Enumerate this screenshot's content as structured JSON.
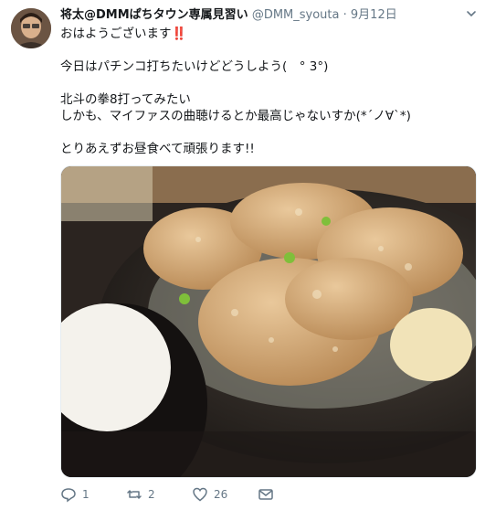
{
  "tweet": {
    "display_name": "将太@DMMぱちタウン専属見習い",
    "handle": "@DMM_syouta",
    "separator": "·",
    "date": "9月12日",
    "lines": [
      "おはようございます‼️",
      "",
      "今日はパチンコ打ちたいけどどうしよう(　° 3°)",
      "",
      "北斗の拳8打ってみたい",
      "しかも、マイファスの曲聴けるとか最高じゃないすか(*´ノ∀`*)",
      "",
      "とりあえずお昼食べて頑張ります!!"
    ],
    "actions": {
      "reply_count": "1",
      "retweet_count": "2",
      "like_count": "26"
    }
  },
  "icons": {
    "reply": "reply-icon",
    "retweet": "retweet-icon",
    "like": "heart-icon",
    "dm": "envelope-icon",
    "menu": "chevron-down-icon"
  },
  "colors": {
    "text": "#14171a",
    "secondary": "#657786",
    "border": "#e6ecf0"
  }
}
